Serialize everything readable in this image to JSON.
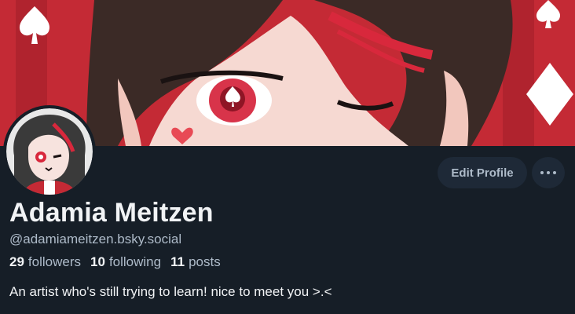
{
  "profile": {
    "name": "Adamia Meitzen",
    "handle": "@adamiameitzen.bsky.social",
    "followers_count": "29",
    "followers_label": "followers",
    "following_count": "10",
    "following_label": "following",
    "posts_count": "11",
    "posts_label": "posts",
    "bio": "An artist who's still trying to learn! nice to meet you >.<"
  },
  "actions": {
    "edit_label": "Edit Profile",
    "more_icon": "ellipsis-icon"
  },
  "colors": {
    "background": "#161e27",
    "banner_red": "#c42a35",
    "button_bg": "#1e2937",
    "muted_text": "#aebbc9"
  }
}
